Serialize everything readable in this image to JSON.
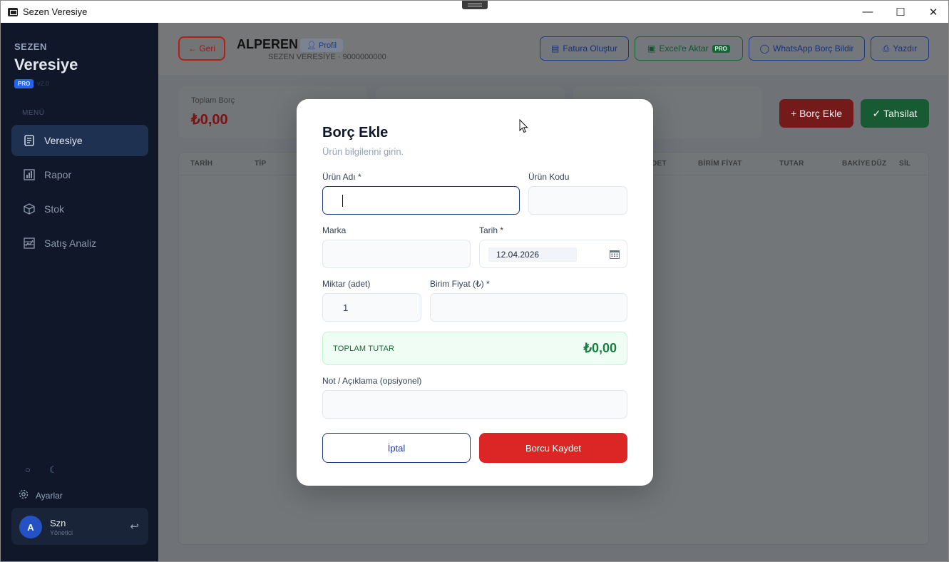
{
  "window": {
    "title": "Sezen Veresiye",
    "minimize": "—",
    "maximize": "☐",
    "close": "✕"
  },
  "sidebar": {
    "brand_small": "SEZEN",
    "brand_big": "Veresiye",
    "pro_badge": "PRO",
    "version": "v2.0",
    "menu_label": "MENÜ",
    "items": [
      {
        "label": "Veresiye",
        "icon": "ledger-icon",
        "active": true
      },
      {
        "label": "Rapor",
        "icon": "bar-chart-icon",
        "active": false
      },
      {
        "label": "Stok",
        "icon": "box-icon",
        "active": false
      },
      {
        "label": "Satış Analiz",
        "icon": "analytics-icon",
        "active": false
      }
    ],
    "settings_label": "Ayarlar",
    "user": {
      "initial": "A",
      "name": "Szn",
      "role": "Yönetici"
    }
  },
  "topbar": {
    "back_label": "← Geri",
    "customer_name": "ALPEREN",
    "profile_label": "Profil",
    "customer_sub": "SEZEN VERESİYE  ·  9000000000",
    "buttons": {
      "invoice": "Fatura Oluştur",
      "excel": "Excel'e Aktar",
      "excel_badge": "PRO",
      "whatsapp": "WhatsApp Borç Bildir",
      "print": "Yazdır"
    }
  },
  "cards": {
    "total_debt_label": "Toplam Borç",
    "total_debt_value": "₺0,00"
  },
  "actions": {
    "add_debt": "+ Borç Ekle",
    "collect": "✓ Tahsilat"
  },
  "table": {
    "headers": [
      "TARİH",
      "TİP",
      "DET",
      "BİRİM FİYAT",
      "TUTAR",
      "BAKİYE",
      "DÜZ",
      "SİL"
    ]
  },
  "modal": {
    "title": "Borç Ekle",
    "subtitle": "Ürün bilgilerini girin.",
    "fields": {
      "product_name": {
        "label": "Ürün Adı *",
        "value": ""
      },
      "product_code": {
        "label": "Ürün Kodu",
        "value": ""
      },
      "brand": {
        "label": "Marka",
        "value": ""
      },
      "date": {
        "label": "Tarih *",
        "value": "12.04.2026"
      },
      "quantity": {
        "label": "Miktar (adet)",
        "value": "1"
      },
      "unit_price": {
        "label": "Birim Fiyat (₺) *",
        "value": ""
      },
      "note": {
        "label": "Not / Açıklama (opsiyonel)",
        "value": ""
      }
    },
    "total_label": "TOPLAM TUTAR",
    "total_value": "₺0,00",
    "cancel_label": "İptal",
    "save_label": "Borcu Kaydet"
  }
}
